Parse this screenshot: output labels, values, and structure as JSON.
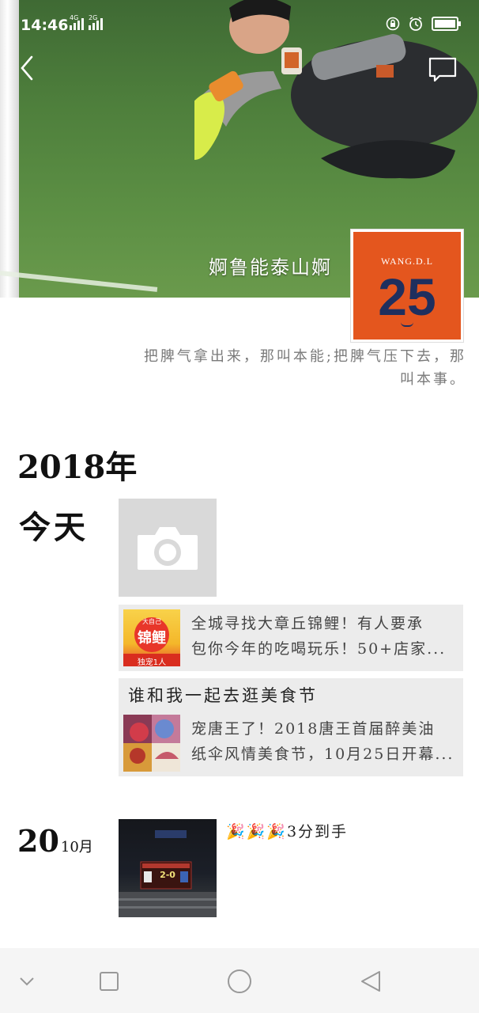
{
  "status_bar": {
    "time": "14:46",
    "net1": "4G",
    "net2": "2G"
  },
  "profile": {
    "nickname": "婀鲁能泰山婀",
    "signature_line1": "把脾气拿出来，那叫本能;把脾气压下去，那",
    "signature_line2": "叫本事。",
    "avatar": {
      "brand_text": "WANG.D.L",
      "number": "25",
      "bg_color": "#e4561e",
      "number_color": "#1e2f5e"
    }
  },
  "timeline": {
    "year": "2018年",
    "today_label": "今天",
    "share1": {
      "thumb_top": "大自己",
      "thumb_main": "锦鲤",
      "thumb_bottom": "独宠1人",
      "line1": "全城寻找大章丘锦鲤！有人要承",
      "line2": "包你今年的吃喝玩乐！50+店家..."
    },
    "share2": {
      "title": "谁和我一起去逛美食节",
      "line1": "宠唐王了！2018唐王首届醉美油",
      "line2": "纸伞风情美食节，10月25日开幕..."
    },
    "entry2": {
      "day": "20",
      "month": "10月",
      "text": "🎉🎉🎉3分到手",
      "score": "2-0"
    }
  },
  "colors": {
    "nav_bg": "#f5f5f5",
    "card_bg": "#ececec"
  }
}
